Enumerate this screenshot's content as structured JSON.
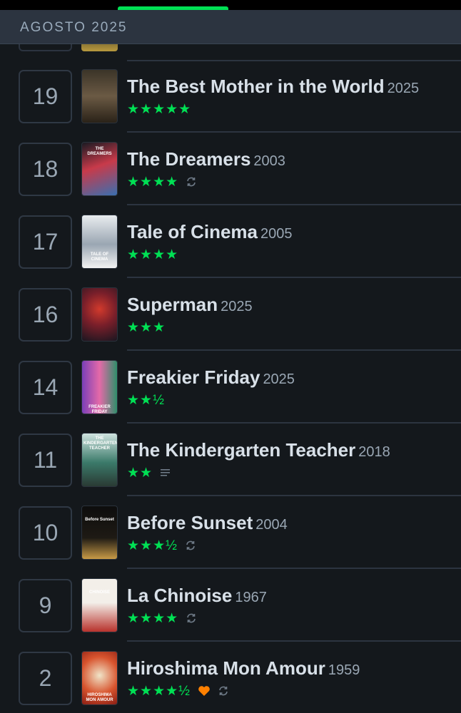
{
  "header": {
    "month": "AGOSTO 2025"
  },
  "colors": {
    "accent": "#00e054",
    "like": "#ff8000",
    "background": "#14181c"
  },
  "entries": [
    {
      "day": "19",
      "title": "The Best Mother in the World",
      "year": "2025",
      "rating": "★★★★★",
      "icons": [],
      "poster": {
        "caption": ""
      }
    },
    {
      "day": "18",
      "title": "The Dreamers",
      "year": "2003",
      "rating": "★★★★",
      "icons": [
        "rewatch-icon"
      ],
      "poster": {
        "caption": "THE DREAMERS"
      }
    },
    {
      "day": "17",
      "title": "Tale of Cinema",
      "year": "2005",
      "rating": "★★★★",
      "icons": [],
      "poster": {
        "caption": "TALE OF CINEMA"
      }
    },
    {
      "day": "16",
      "title": "Superman",
      "year": "2025",
      "rating": "★★★",
      "icons": [],
      "poster": {
        "caption": ""
      }
    },
    {
      "day": "14",
      "title": "Freakier Friday",
      "year": "2025",
      "rating": "★★½",
      "icons": [],
      "poster": {
        "caption": "FREAKIER FRIDAY"
      }
    },
    {
      "day": "11",
      "title": "The Kindergarten Teacher",
      "year": "2018",
      "rating": "★★",
      "icons": [
        "review-icon"
      ],
      "poster": {
        "caption": "THE KINDERGARTEN TEACHER"
      }
    },
    {
      "day": "10",
      "title": "Before Sunset",
      "year": "2004",
      "rating": "★★★½",
      "icons": [
        "rewatch-icon"
      ],
      "poster": {
        "caption": "Before Sunset"
      }
    },
    {
      "day": "9",
      "title": "La Chinoise",
      "year": "1967",
      "rating": "★★★★",
      "icons": [
        "rewatch-icon"
      ],
      "poster": {
        "caption": "CHINOISE"
      }
    },
    {
      "day": "2",
      "title": "Hiroshima Mon Amour",
      "year": "1959",
      "rating": "★★★★½",
      "icons": [
        "heart-icon",
        "rewatch-icon"
      ],
      "poster": {
        "caption": "HIROSHIMA MON AMOUR"
      }
    }
  ]
}
